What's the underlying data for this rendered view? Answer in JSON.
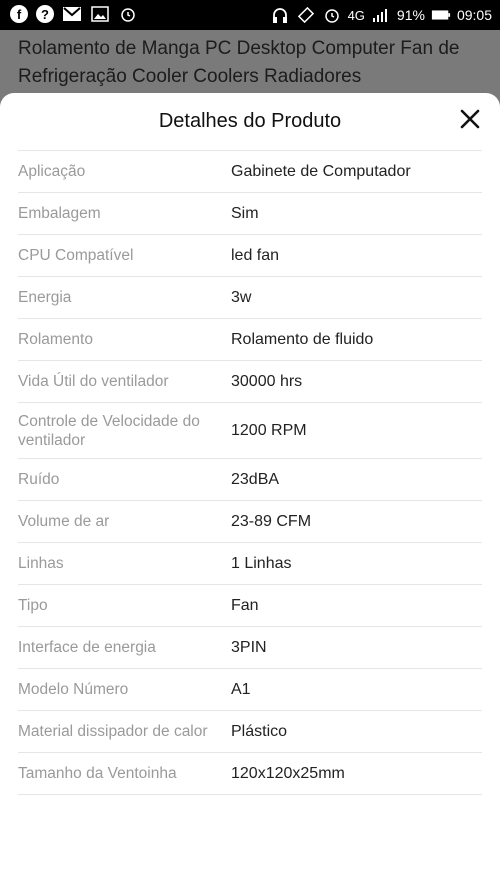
{
  "status_bar": {
    "left_icons": [
      "facebook-icon",
      "question-icon",
      "gmail-icon",
      "image-icon",
      "alarm-icon"
    ],
    "right_icons": [
      "headphones-icon",
      "screen-rotation-icon",
      "alarm-icon"
    ],
    "network": "4G",
    "battery": "91%",
    "time": "09:05"
  },
  "background_title": "Rolamento de Manga PC Desktop Computer Fan de Refrigeração Cooler Coolers Radiadores",
  "sheet": {
    "title": "Detalhes do Produto",
    "rows": [
      {
        "label": "Aplicação",
        "value": "Gabinete de Computador"
      },
      {
        "label": "Embalagem",
        "value": "Sim"
      },
      {
        "label": "CPU Compatível",
        "value": "led fan"
      },
      {
        "label": "Energia",
        "value": "3w"
      },
      {
        "label": "Rolamento",
        "value": "Rolamento de fluido"
      },
      {
        "label": "Vida Útil do ventilador",
        "value": "30000 hrs"
      },
      {
        "label": "Controle de Velocidade do ventilador",
        "value": "1200 RPM"
      },
      {
        "label": "Ruído",
        "value": "23dBA"
      },
      {
        "label": "Volume de ar",
        "value": "23-89 CFM"
      },
      {
        "label": "Linhas",
        "value": "1 Linhas"
      },
      {
        "label": "Tipo",
        "value": "Fan"
      },
      {
        "label": "Interface de energia",
        "value": "3PIN"
      },
      {
        "label": "Modelo Número",
        "value": "A1"
      },
      {
        "label": "Material dissipador de calor",
        "value": "Plástico"
      },
      {
        "label": "Tamanho da Ventoinha",
        "value": "120x120x25mm"
      }
    ]
  }
}
